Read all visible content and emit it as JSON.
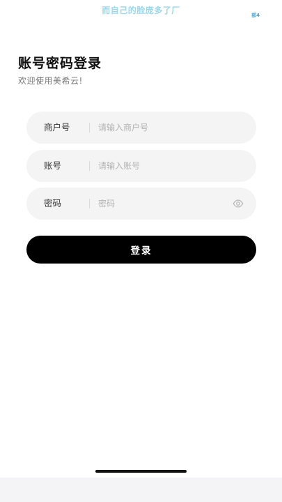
{
  "status_bar": {
    "marquee_text": "而自己的脸庞多了厂",
    "badge_text": "部4"
  },
  "header": {
    "title": "账号密码登录",
    "subtitle": "欢迎使用美希云!"
  },
  "form": {
    "merchant": {
      "label": "商户号",
      "placeholder": "请输入商户号",
      "value": ""
    },
    "account": {
      "label": "账号",
      "placeholder": "请输入账号",
      "value": ""
    },
    "password": {
      "label": "密码",
      "placeholder": "密码",
      "value": "",
      "toggle_icon": "eye-icon"
    }
  },
  "actions": {
    "login_label": "登录"
  },
  "colors": {
    "primary_button": "#000000",
    "field_background": "#f4f4f4",
    "placeholder": "#b3b3b3"
  }
}
